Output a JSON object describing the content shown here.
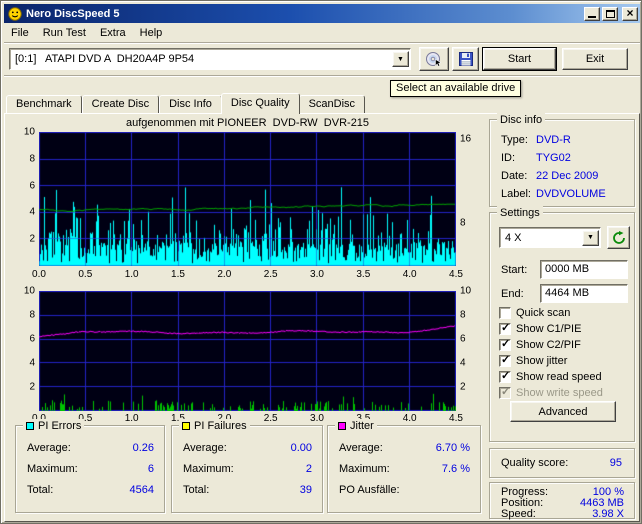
{
  "window": {
    "title": "Nero DiscSpeed 5"
  },
  "menu": {
    "items": [
      {
        "label": "File"
      },
      {
        "label": "Run Test"
      },
      {
        "label": "Extra"
      },
      {
        "label": "Help"
      }
    ]
  },
  "toolbar": {
    "drive_combo_value": "[0:1]   ATAPI DVD A  DH20A4P 9P54",
    "start_label": "Start",
    "exit_label": "Exit",
    "drive_tooltip": "Select an available drive"
  },
  "tabs": [
    {
      "label": "Benchmark",
      "active": false
    },
    {
      "label": "Create Disc",
      "active": false
    },
    {
      "label": "Disc Info",
      "active": false
    },
    {
      "label": "Disc Quality",
      "active": true
    },
    {
      "label": "ScanDisc",
      "active": false
    }
  ],
  "chart": {
    "header": "aufgenommen mit PIONEER  DVD-RW  DVR-215"
  },
  "chart_data": [
    {
      "type": "area",
      "name": "PI Errors vs disc position (GB)",
      "x_range": [
        0,
        4.5
      ],
      "x_ticks": [
        "0.0",
        "0.5",
        "1.0",
        "1.5",
        "2.0",
        "2.5",
        "3.0",
        "3.5",
        "4.0",
        "4.5"
      ],
      "y_left_range": [
        0,
        10
      ],
      "y_left_ticks": [
        10,
        8,
        6,
        4,
        2
      ],
      "y_right_ticks": [
        {
          "label": "16",
          "frac": 0.05
        },
        {
          "label": "8",
          "frac": 0.68
        }
      ],
      "grid": true,
      "series": [
        {
          "name": "PI Errors",
          "color": "#00ffff",
          "style": "spikes",
          "average": 0.26,
          "maximum": 6,
          "total": 4564
        },
        {
          "name": "Read speed",
          "color": "#00a400",
          "style": "line",
          "approx_level": 4.2
        }
      ]
    },
    {
      "type": "line",
      "name": "Jitter and PI Failures vs disc position (GB)",
      "x_range": [
        0,
        4.5
      ],
      "x_ticks": [
        "0.0",
        "0.5",
        "1.0",
        "1.5",
        "2.0",
        "2.5",
        "3.0",
        "3.5",
        "4.0",
        "4.5"
      ],
      "y_left_range": [
        0,
        10
      ],
      "y_left_ticks": [
        10,
        8,
        6,
        4,
        2
      ],
      "y_right_ticks": [
        10,
        8,
        6,
        4,
        2
      ],
      "grid": true,
      "series": [
        {
          "name": "Jitter",
          "color": "#ff00ff",
          "style": "line",
          "average_pct": 6.7,
          "maximum_pct": 7.6
        },
        {
          "name": "PI Failures",
          "color": "#00c400",
          "style": "spikes",
          "average": 0.0,
          "maximum": 2,
          "total": 39
        }
      ]
    }
  ],
  "disc_info": {
    "title": "Disc info",
    "rows": [
      {
        "label": "Type:",
        "value": "DVD-R"
      },
      {
        "label": "ID:",
        "value": "TYG02"
      },
      {
        "label": "Date:",
        "value": "22 Dec 2009"
      },
      {
        "label": "Label:",
        "value": "DVDVOLUME"
      }
    ]
  },
  "settings": {
    "title": "Settings",
    "speed_value": "4 X",
    "start_label": "Start:",
    "start_value": "0000 MB",
    "end_label": "End:",
    "end_value": "4464 MB",
    "checkboxes": [
      {
        "label": "Quick scan",
        "checked": false,
        "disabled": false
      },
      {
        "label": "Show C1/PIE",
        "checked": true,
        "disabled": false
      },
      {
        "label": "Show C2/PIF",
        "checked": true,
        "disabled": false
      },
      {
        "label": "Show jitter",
        "checked": true,
        "disabled": false
      },
      {
        "label": "Show read speed",
        "checked": true,
        "disabled": false
      },
      {
        "label": "Show write speed",
        "checked": true,
        "disabled": true
      }
    ],
    "advanced_label": "Advanced"
  },
  "quality": {
    "label": "Quality score:",
    "value": "95"
  },
  "progress": {
    "rows": [
      {
        "label": "Progress:",
        "value": "100 %"
      },
      {
        "label": "Position:",
        "value": "4463 MB"
      },
      {
        "label": "Speed:",
        "value": "3.98 X"
      }
    ]
  },
  "legend_panels": [
    {
      "title": "PI Errors",
      "color": "#00ffff",
      "rows": [
        {
          "label": "Average:",
          "value": "0.26"
        },
        {
          "label": "Maximum:",
          "value": "6"
        },
        {
          "label": "Total:",
          "value": "4564"
        }
      ]
    },
    {
      "title": "PI Failures",
      "color": "#ffff00",
      "rows": [
        {
          "label": "Average:",
          "value": "0.00"
        },
        {
          "label": "Maximum:",
          "value": "2"
        },
        {
          "label": "Total:",
          "value": "39"
        }
      ]
    },
    {
      "title": "Jitter",
      "color": "#ff00ff",
      "rows": [
        {
          "label": "Average:",
          "value": "6.70 %"
        },
        {
          "label": "Maximum:",
          "value": "7.6 %"
        },
        {
          "label": "PO Ausfälle:",
          "value": ""
        }
      ]
    }
  ]
}
